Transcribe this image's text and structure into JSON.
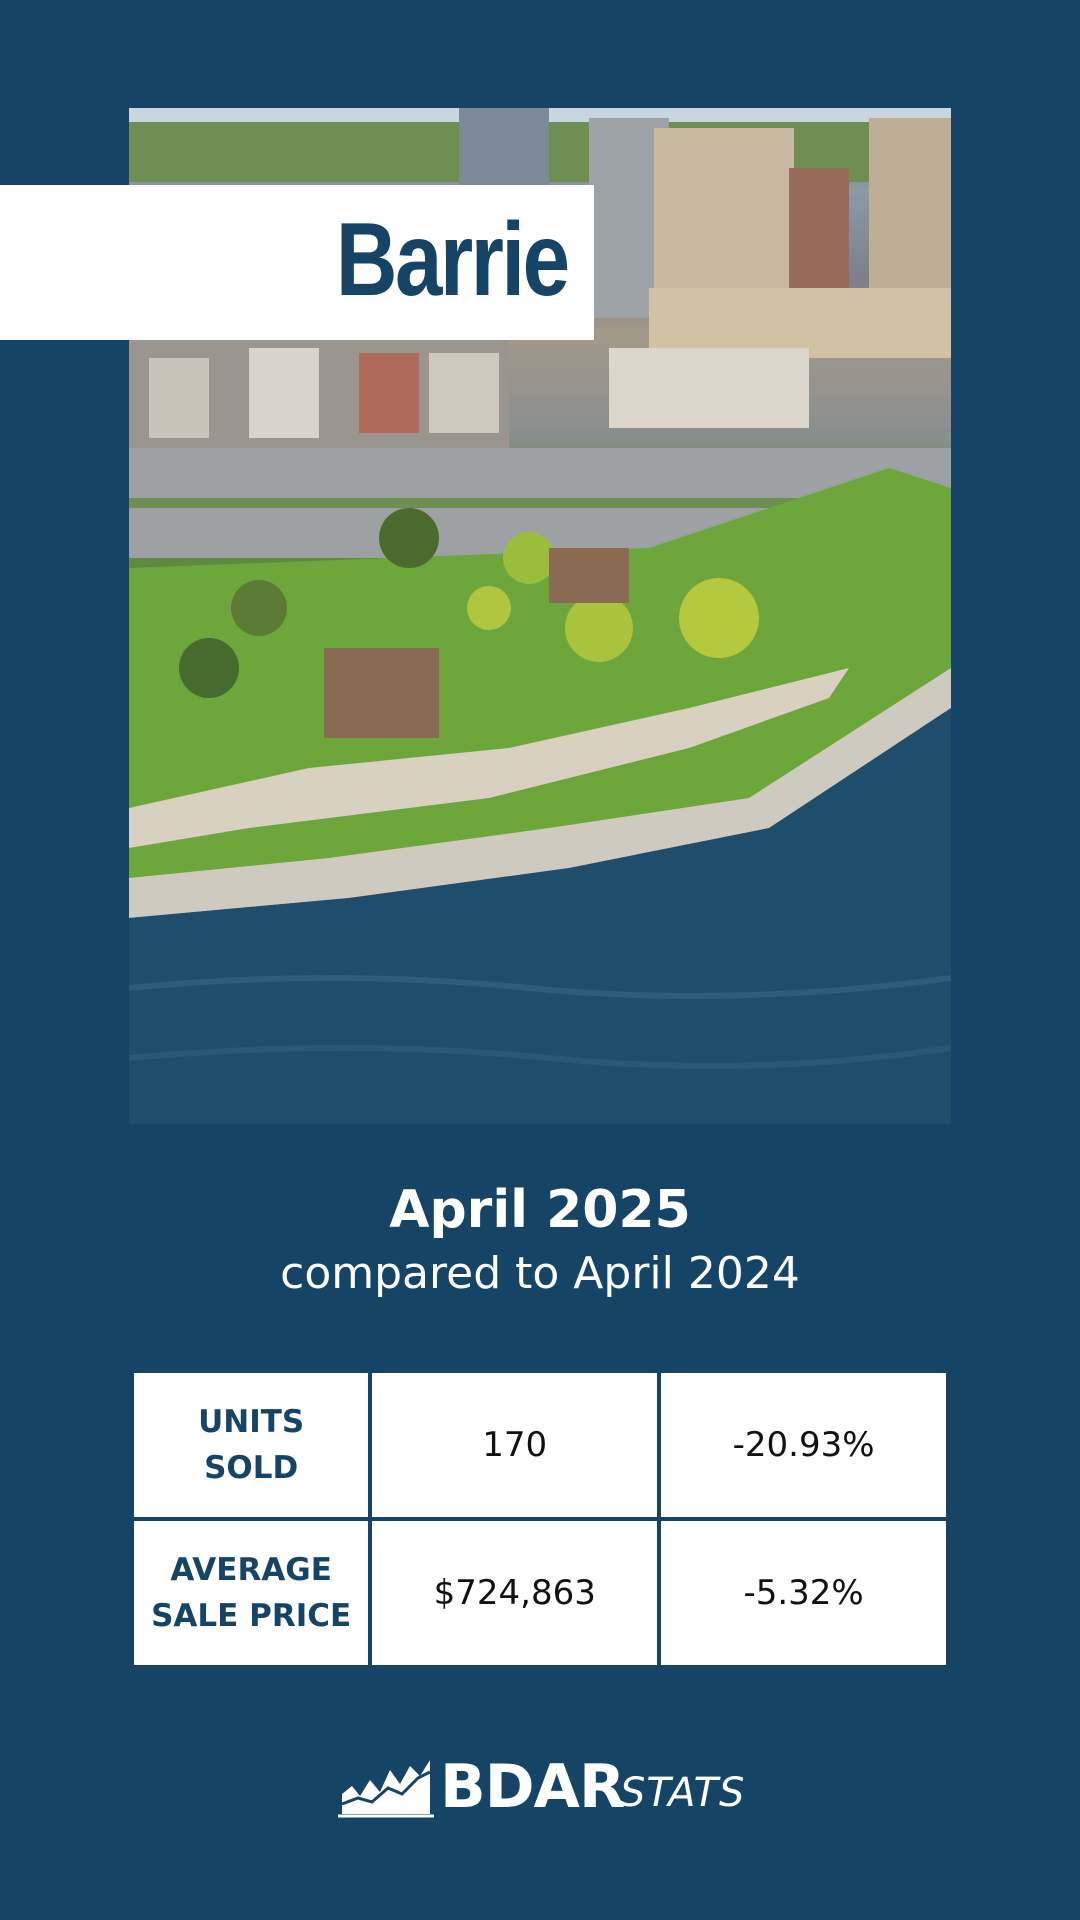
{
  "hero": {
    "city": "Barrie"
  },
  "period": {
    "title": "April 2025",
    "comparison": "compared to April 2024"
  },
  "stats": {
    "rows": [
      {
        "label": "UNITS\nSOLD",
        "value": "170",
        "change": "-20.93%"
      },
      {
        "label": "AVERAGE\nSALE PRICE",
        "value": "$724,863",
        "change": "-5.32%"
      }
    ]
  },
  "logo": {
    "brand": "BDAR",
    "sub": "STATS"
  },
  "colors": {
    "background": "#154466",
    "panel": "#ffffff",
    "accent_text": "#154466"
  }
}
